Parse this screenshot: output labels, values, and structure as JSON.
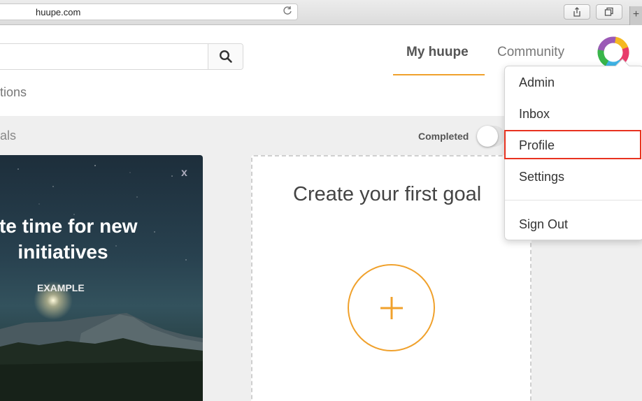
{
  "browser": {
    "url": "huupe.com",
    "new_tab_icon": "+"
  },
  "header": {
    "nav": {
      "my_huupe": "My huupe",
      "community": "Community"
    },
    "sub_tab_label": "tions"
  },
  "content": {
    "section_label": "als",
    "completed_label": "Completed",
    "completed_toggle_on": false,
    "example_card": {
      "close": "x",
      "title": "ate time for new initiatives",
      "example_tag": "EXAMPLE"
    },
    "create_card": {
      "title": "Create your first goal",
      "add_symbol": "+"
    }
  },
  "dropdown": {
    "items": [
      "Admin",
      "Inbox",
      "Profile",
      "Settings",
      "Sign Out"
    ],
    "highlighted": "Profile"
  },
  "colors": {
    "accent": "#f0a12c",
    "highlight_border": "#e8321f"
  }
}
